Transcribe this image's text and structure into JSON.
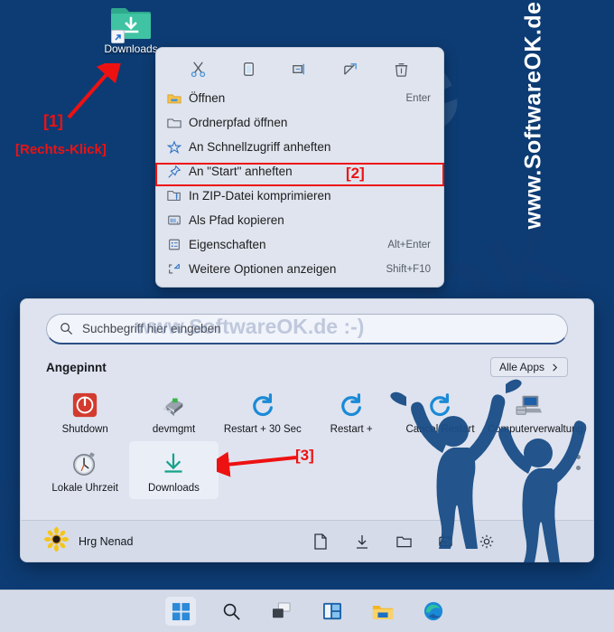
{
  "desktop": {
    "background_color": "#0d3c74",
    "icon": {
      "name": "Downloads",
      "icon": "folder-download-icon",
      "shortcut_overlay": "shortcut-arrow-icon"
    }
  },
  "watermarks": {
    "vertical": "www.SoftwareOK.de :-)",
    "center": "www.SoftwareOK.de :-)",
    "diagonal_1": "de",
    "diagonal_2": "SoftwareOK"
  },
  "annotations": {
    "step1": "[1]",
    "right_click": "[Rechts-Klick]",
    "step2": "[2]",
    "step3": "[3]",
    "accent_color": "#ee1111"
  },
  "context_menu": {
    "toolbar": [
      {
        "name": "cut",
        "icon": "scissors-icon"
      },
      {
        "name": "copy",
        "icon": "copy-icon"
      },
      {
        "name": "rename",
        "icon": "rename-icon"
      },
      {
        "name": "share",
        "icon": "share-icon"
      },
      {
        "name": "delete",
        "icon": "trash-icon"
      }
    ],
    "items": [
      {
        "label": "Öffnen",
        "accel": "Enter",
        "icon": "folder-open-icon",
        "highlighted": false
      },
      {
        "label": "Ordnerpfad öffnen",
        "accel": "",
        "icon": "folder-icon",
        "highlighted": false
      },
      {
        "label": "An Schnellzugriff anheften",
        "accel": "",
        "icon": "star-icon",
        "highlighted": false
      },
      {
        "label": "An \"Start\" anheften",
        "accel": "",
        "icon": "pin-icon",
        "highlighted": true
      },
      {
        "label": "In ZIP-Datei komprimieren",
        "accel": "",
        "icon": "zip-icon",
        "highlighted": false
      },
      {
        "label": "Als Pfad kopieren",
        "accel": "",
        "icon": "copy-path-icon",
        "highlighted": false
      },
      {
        "label": "Eigenschaften",
        "accel": "Alt+Enter",
        "icon": "properties-icon",
        "highlighted": false
      },
      {
        "label": "Weitere Optionen anzeigen",
        "accel": "Shift+F10",
        "icon": "more-options-icon",
        "highlighted": false
      }
    ]
  },
  "start_menu": {
    "search": {
      "placeholder": "Suchbegriff hier eingeben",
      "icon": "search-icon"
    },
    "pinned_title": "Angepinnt",
    "all_apps_label": "Alle Apps",
    "all_apps_icon": "chevron-right-icon",
    "tiles": [
      {
        "label": "Shutdown",
        "icon": "power-icon",
        "selected": false
      },
      {
        "label": "devmgmt",
        "icon": "device-manager-icon",
        "selected": false
      },
      {
        "label": "Restart + 30 Sec",
        "icon": "restart-icon",
        "selected": false
      },
      {
        "label": "Restart +",
        "icon": "restart-icon",
        "selected": false
      },
      {
        "label": "Cancel Restart",
        "icon": "restart-icon",
        "selected": false
      },
      {
        "label": "Computerverwaltung",
        "icon": "computer-management-icon",
        "selected": false
      },
      {
        "label": "Lokale Uhrzeit",
        "icon": "clock-icon",
        "selected": false
      },
      {
        "label": "Downloads",
        "icon": "download-icon",
        "selected": true
      }
    ],
    "user": {
      "name": "Hrg Nenad",
      "avatar": "sunflower-avatar"
    },
    "bottom_icons": [
      {
        "name": "documents",
        "icon": "document-icon"
      },
      {
        "name": "downloads",
        "icon": "download-icon"
      },
      {
        "name": "folder",
        "icon": "folder-icon"
      },
      {
        "name": "pictures",
        "icon": "pictures-icon"
      },
      {
        "name": "settings",
        "icon": "gear-icon"
      }
    ]
  },
  "taskbar": {
    "buttons": [
      {
        "name": "start",
        "icon": "windows-logo-icon",
        "active": true
      },
      {
        "name": "search",
        "icon": "search-icon",
        "active": false
      },
      {
        "name": "task-view",
        "icon": "task-view-icon",
        "active": false
      },
      {
        "name": "widgets",
        "icon": "widgets-icon",
        "active": false
      },
      {
        "name": "file-explorer",
        "icon": "file-explorer-icon",
        "active": false
      },
      {
        "name": "edge",
        "icon": "edge-icon",
        "active": false
      }
    ]
  }
}
